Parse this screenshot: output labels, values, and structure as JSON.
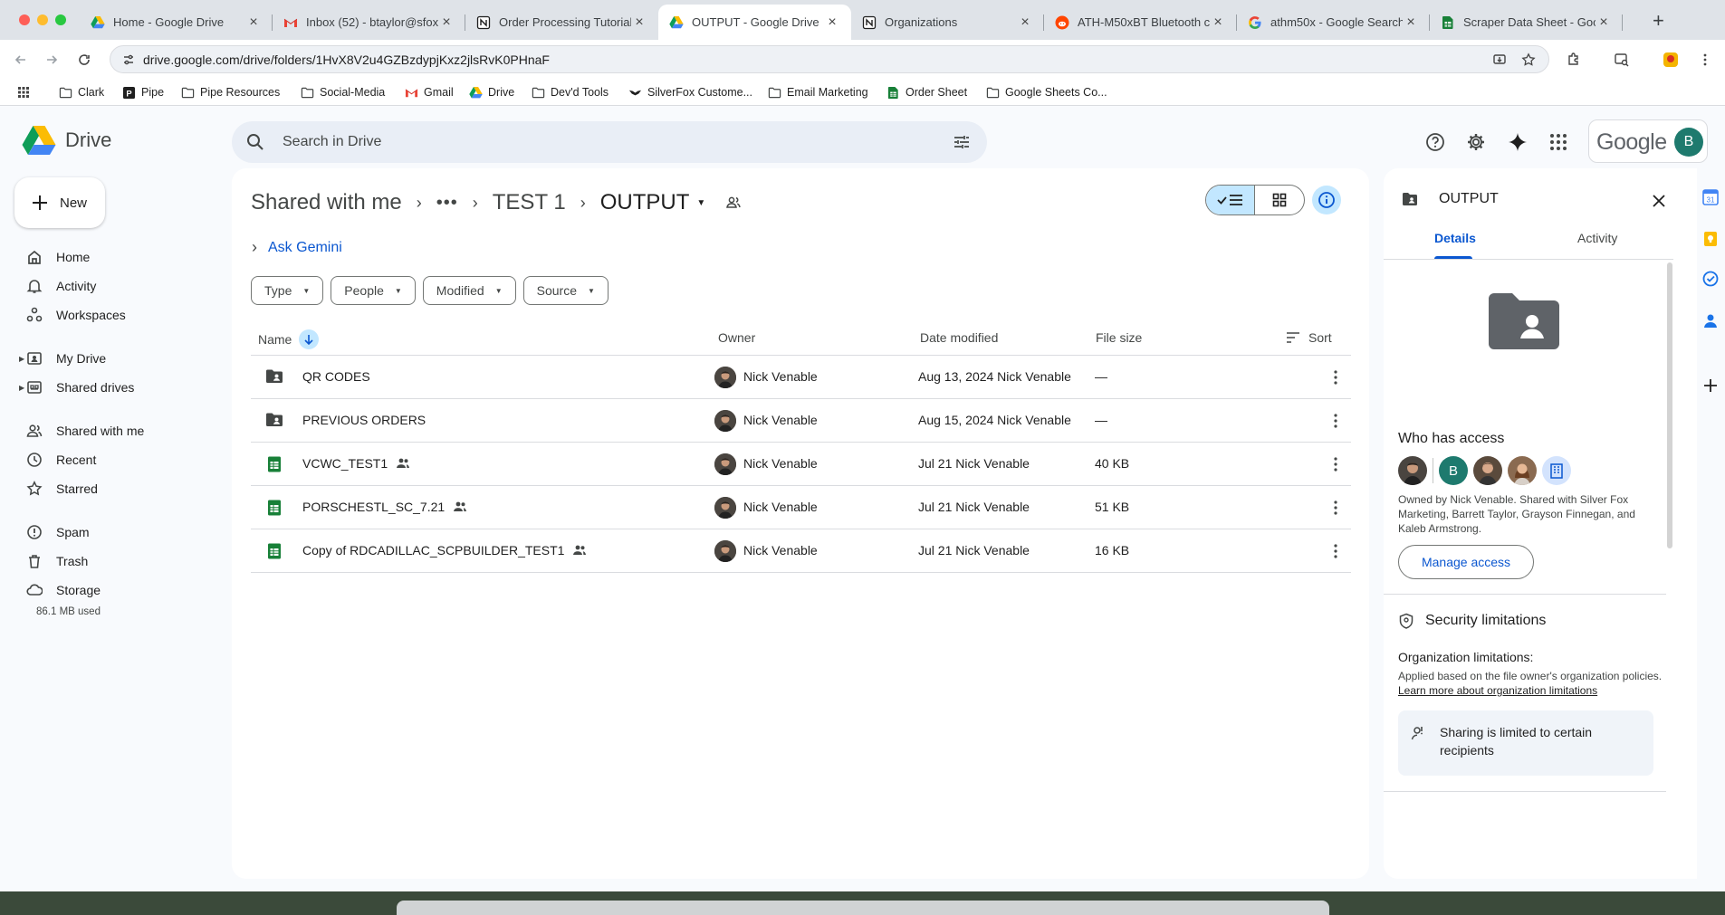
{
  "browser": {
    "tabs": [
      {
        "title": "Home - Google Drive",
        "icon": "google-drive-icon"
      },
      {
        "title": "Inbox (52) - btaylor@sfox",
        "icon": "gmail-icon"
      },
      {
        "title": "Order Processing Tutorial",
        "icon": "notion-icon"
      },
      {
        "title": "OUTPUT - Google Drive",
        "icon": "google-drive-icon"
      },
      {
        "title": "Organizations",
        "icon": "notion-icon"
      },
      {
        "title": "ATH-M50xBT Bluetooth c",
        "icon": "reddit-icon"
      },
      {
        "title": "athm50x - Google Search",
        "icon": "google-icon"
      },
      {
        "title": "Scraper Data Sheet - Goo",
        "icon": "google-sheets-icon"
      }
    ],
    "url": "drive.google.com/drive/folders/1HvX8V2u4GZBzdypjKxz2jlsRvK0PHnaF",
    "bookmarks": [
      {
        "label": "Clark",
        "icon": "folder-icon"
      },
      {
        "label": "Pipe",
        "icon": "pipe-icon"
      },
      {
        "label": "Pipe Resources",
        "icon": "folder-icon"
      },
      {
        "label": "Social-Media",
        "icon": "folder-icon"
      },
      {
        "label": "Gmail",
        "icon": "gmail-icon"
      },
      {
        "label": "Drive",
        "icon": "google-drive-icon"
      },
      {
        "label": "Dev'd Tools",
        "icon": "folder-icon"
      },
      {
        "label": "SilverFox Custome...",
        "icon": "fox-icon"
      },
      {
        "label": "Email Marketing",
        "icon": "folder-icon"
      },
      {
        "label": "Order Sheet",
        "icon": "google-sheets-icon"
      },
      {
        "label": "Google Sheets Co...",
        "icon": "folder-icon"
      }
    ]
  },
  "drive": {
    "app_name": "Drive",
    "search_placeholder": "Search in Drive",
    "account_wordmark": "Google",
    "account_initial": "B",
    "new_label": "New",
    "nav": {
      "home": "Home",
      "activity": "Activity",
      "workspaces": "Workspaces",
      "my_drive": "My Drive",
      "shared_drives": "Shared drives",
      "shared_with_me": "Shared with me",
      "recent": "Recent",
      "starred": "Starred",
      "spam": "Spam",
      "trash": "Trash",
      "storage": "Storage"
    },
    "storage_used": "86.1 MB used",
    "breadcrumb": {
      "root": "Shared with me",
      "middle": "TEST 1",
      "current": "OUTPUT"
    },
    "ask_gemini": "Ask Gemini",
    "filters": {
      "type": "Type",
      "people": "People",
      "modified": "Modified",
      "source": "Source"
    },
    "columns": {
      "name": "Name",
      "owner": "Owner",
      "date_modified": "Date modified",
      "file_size": "File size",
      "sort": "Sort"
    },
    "files": [
      {
        "name": "QR CODES",
        "kind": "shared-folder",
        "shared": false,
        "owner": "Nick Venable",
        "modified": "Aug 13, 2024 Nick Venable",
        "size": "—"
      },
      {
        "name": "PREVIOUS ORDERS",
        "kind": "shared-folder",
        "shared": false,
        "owner": "Nick Venable",
        "modified": "Aug 15, 2024 Nick Venable",
        "size": "—"
      },
      {
        "name": "VCWC_TEST1",
        "kind": "spreadsheet",
        "shared": true,
        "owner": "Nick Venable",
        "modified": "Jul 21 Nick Venable",
        "size": "40 KB"
      },
      {
        "name": "PORSCHESTL_SC_7.21",
        "kind": "spreadsheet",
        "shared": true,
        "owner": "Nick Venable",
        "modified": "Jul 21 Nick Venable",
        "size": "51 KB"
      },
      {
        "name": "Copy of RDCADILLAC_SCPBUILDER_TEST1",
        "kind": "spreadsheet",
        "shared": true,
        "owner": "Nick Venable",
        "modified": "Jul 21 Nick Venable",
        "size": "16 KB"
      }
    ]
  },
  "details": {
    "title": "OUTPUT",
    "tab_details": "Details",
    "tab_activity": "Activity",
    "who_has_access": "Who has access",
    "access_avatar_initial": "B",
    "access_text": "Owned by Nick Venable. Shared with Silver Fox Marketing, Barrett Taylor, Grayson Finnegan, and Kaleb Armstrong.",
    "manage_access": "Manage access",
    "security_title": "Security limitations",
    "org_title": "Organization limitations:",
    "org_text": "Applied based on the file owner's organization policies. ",
    "org_link": "Learn more about organization limitations",
    "limit_text": "Sharing is limited to certain recipients"
  },
  "colors": {
    "accent_blue": "#0b57d0",
    "selected_bg": "#c2e7ff",
    "sheets_green": "#188038",
    "folder_gray": "#444746"
  }
}
